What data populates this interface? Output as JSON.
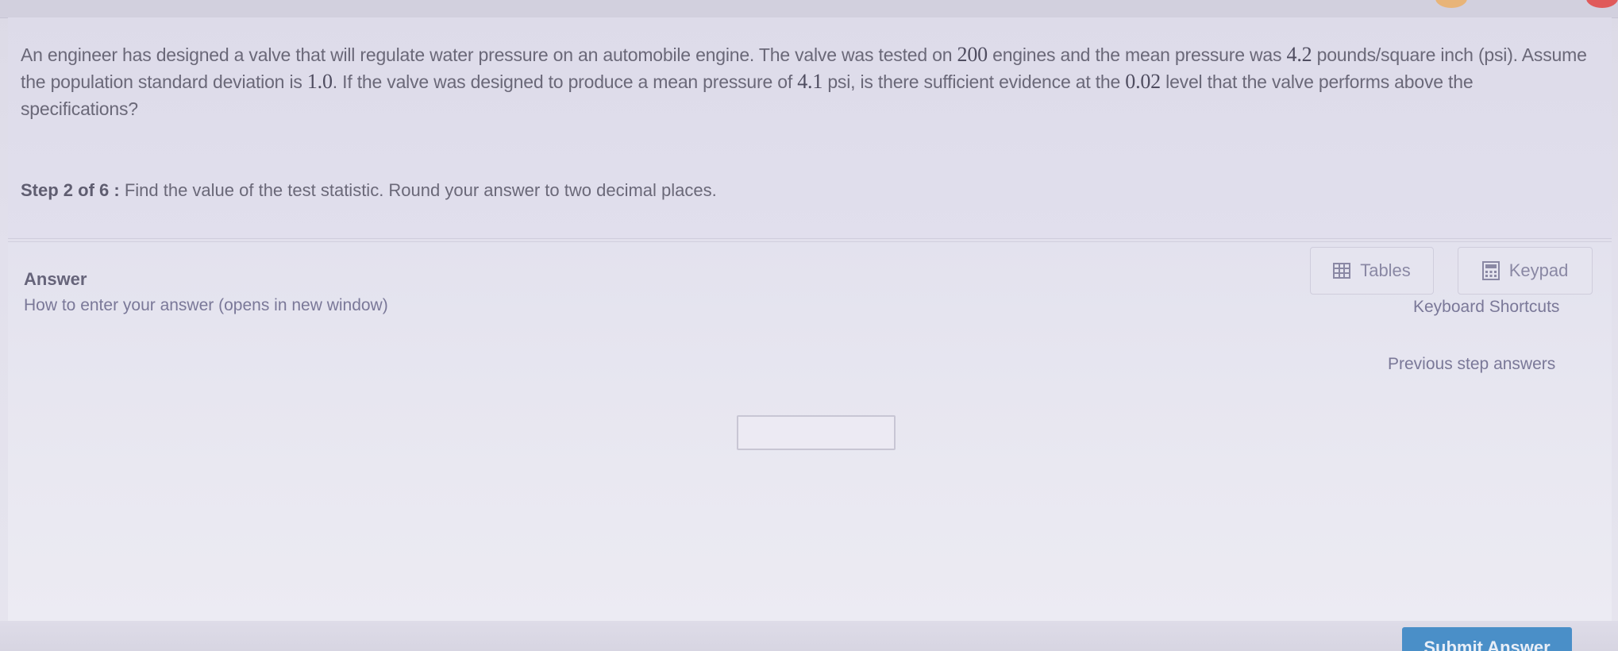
{
  "question": {
    "seg1": "An engineer has designed a valve that will regulate water pressure on an automobile engine. The valve was tested on ",
    "num_engines": "200",
    "seg2": " engines and the mean pressure was ",
    "mean_pressure": "4.2",
    "seg3": " pounds/square inch (psi). Assume the population standard deviation is ",
    "std_dev": "1.0",
    "seg4": ". If the valve was designed to produce a mean pressure of ",
    "design_mean": "4.1",
    "seg5": " psi, is there sufficient evidence at the ",
    "level": "0.02",
    "seg6": " level that the valve performs above the specifications?"
  },
  "step": {
    "label": "Step 2 of 6 :",
    "instruction": "Find the value of the test statistic. Round your answer to two decimal places."
  },
  "answer": {
    "label": "Answer",
    "how_to_link": "How to enter your answer (opens in new window)",
    "input_value": ""
  },
  "tools": {
    "tables_label": "Tables",
    "keypad_label": "Keypad",
    "keyboard_shortcuts": "Keyboard Shortcuts",
    "previous_step_answers": "Previous step answers"
  },
  "submit": {
    "label": "Submit Answer"
  },
  "colors": {
    "background": "#dcdae6",
    "text": "#6a6878",
    "link": "#7a7898",
    "submit": "#4a8fc8",
    "top_dot_orange": "#e8b478",
    "top_dot_red": "#e05a5a"
  },
  "icons": {
    "tables": "table-grid-icon",
    "keypad": "calculator-keypad-icon"
  }
}
